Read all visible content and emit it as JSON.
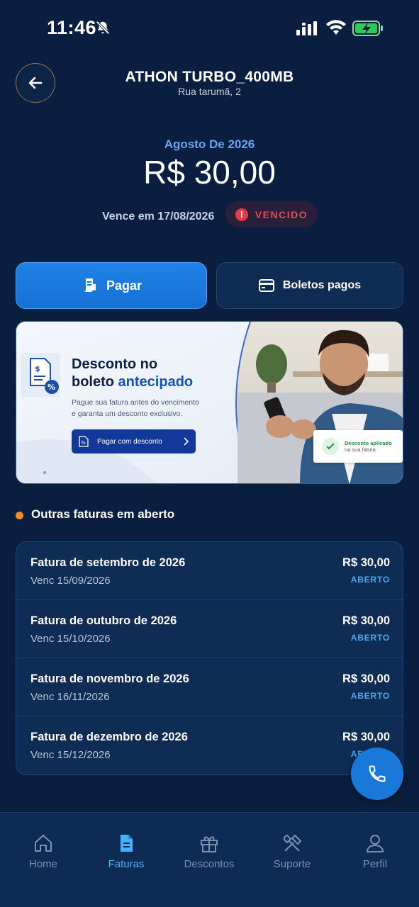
{
  "status_bar": {
    "time": "11:46"
  },
  "header": {
    "title": "ATHON TURBO_400MB",
    "address": "Rua tarumã, 2"
  },
  "invoice": {
    "month": "Agosto De 2026",
    "amount": "R$ 30,00",
    "due": "Vence em 17/08/2026",
    "status_icon": "!",
    "status": "VENCIDO"
  },
  "actions": {
    "pay_label": "Pagar",
    "paid_label": "Boletos pagos"
  },
  "banner": {
    "title_line1": "Desconto no",
    "title_line2_prefix": "boleto ",
    "title_line2_highlight": "antecipado",
    "subtitle_line1": "Pague sua fatura antes do vencimento",
    "subtitle_line2": "e garanta um desconto exclusivo.",
    "cta_label": "Pagar com desconto",
    "pill_title": "Desconto aplicado",
    "pill_sub": "na sua fatura"
  },
  "section": {
    "title": "Outras faturas em aberto"
  },
  "invoices": [
    {
      "title": "Fatura de setembro de 2026",
      "due": "Venc 15/09/2026",
      "amount": "R$ 30,00",
      "status": "ABERTO"
    },
    {
      "title": "Fatura de outubro de 2026",
      "due": "Venc 15/10/2026",
      "amount": "R$ 30,00",
      "status": "ABERTO"
    },
    {
      "title": "Fatura de novembro de 2026",
      "due": "Venc 16/11/2026",
      "amount": "R$ 30,00",
      "status": "ABERTO"
    },
    {
      "title": "Fatura de dezembro de 2026",
      "due": "Venc 15/12/2026",
      "amount": "R$ 30,00",
      "status": "ABERTO"
    }
  ],
  "nav": [
    {
      "label": "Home",
      "icon": "home-icon"
    },
    {
      "label": "Faturas",
      "icon": "document-icon"
    },
    {
      "label": "Descontos",
      "icon": "gift-icon"
    },
    {
      "label": "Suporte",
      "icon": "tools-icon"
    },
    {
      "label": "Perfil",
      "icon": "user-icon"
    }
  ],
  "colors": {
    "background": "#0a1f3f",
    "accent": "#1f82e6",
    "status_overdue": "#e84a5a",
    "status_open": "#4aa8f0",
    "section_dot": "#f08a2a"
  }
}
